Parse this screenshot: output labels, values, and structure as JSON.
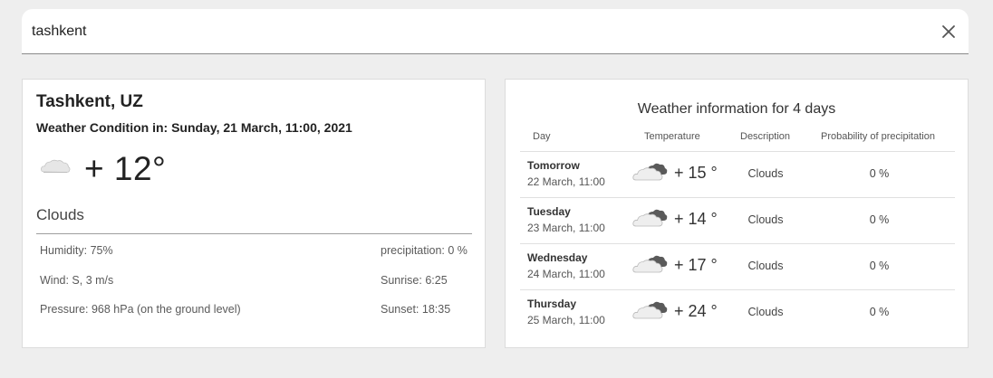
{
  "search": {
    "value": "tashkent",
    "clear_icon": "close-icon"
  },
  "current": {
    "city": "Tashkent, UZ",
    "condition_label": "Weather Condition in: Sunday, 21 March, 11:00, 2021",
    "icon": "cloud-icon",
    "temperature": "+ 12°",
    "description": "Clouds",
    "humidity": "Humidity: 75%",
    "precipitation": "precipitation: 0 %",
    "wind": "Wind: S, 3 m/s",
    "sunrise": "Sunrise: 6:25",
    "pressure": "Pressure: 968 hPa (on the ground level)",
    "sunset": "Sunset: 18:35"
  },
  "forecast": {
    "title": "Weather information for 4 days",
    "headers": {
      "day": "Day",
      "temperature": "Temperature",
      "description": "Description",
      "probability": "Probability of precipitation"
    },
    "rows": [
      {
        "day": "Tomorrow",
        "date": "22 March, 11:00",
        "icon": "clouds-icon",
        "temp": "+ 15 °",
        "desc": "Clouds",
        "prob": "0 %"
      },
      {
        "day": "Tuesday",
        "date": "23 March, 11:00",
        "icon": "clouds-icon",
        "temp": "+ 14 °",
        "desc": "Clouds",
        "prob": "0 %"
      },
      {
        "day": "Wednesday",
        "date": "24 March, 11:00",
        "icon": "clouds-icon",
        "temp": "+ 17 °",
        "desc": "Clouds",
        "prob": "0 %"
      },
      {
        "day": "Thursday",
        "date": "25 March, 11:00",
        "icon": "clouds-icon",
        "temp": "+ 24 °",
        "desc": "Clouds",
        "prob": "0 %"
      }
    ]
  }
}
